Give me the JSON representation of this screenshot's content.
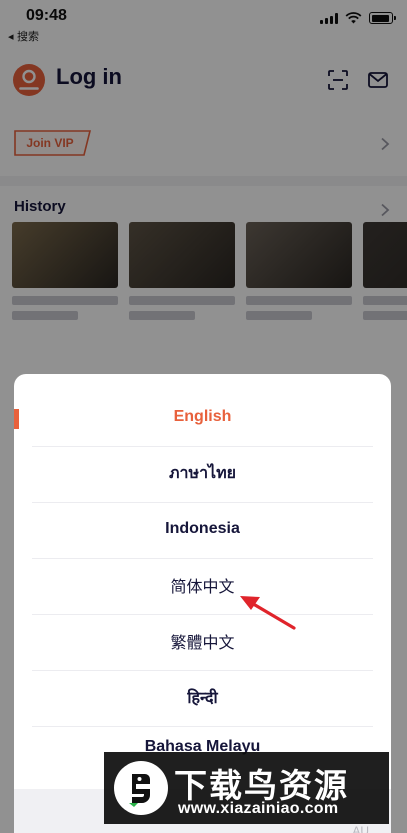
{
  "status_bar": {
    "time": "09:48",
    "back_app_label": "◂ 搜索",
    "battery_level": 0.9
  },
  "header": {
    "title": "Log in",
    "avatar_icon": "user-icon",
    "scan_icon": "scan-icon",
    "mail_icon": "mail-icon"
  },
  "vip": {
    "label": "Join VIP"
  },
  "history": {
    "title": "History",
    "items": [
      {
        "thumb_color": "#7b6a4c"
      },
      {
        "thumb_color": "#5e5446"
      },
      {
        "thumb_color": "#6b6258"
      },
      {
        "thumb_color": "#3f3a36"
      }
    ]
  },
  "language_sheet": {
    "options": [
      {
        "label": "English",
        "selected": true
      },
      {
        "label": "ภาษาไทย",
        "selected": false
      },
      {
        "label": "Indonesia",
        "selected": false
      },
      {
        "label": "简体中文",
        "selected": false
      },
      {
        "label": "繁體中文",
        "selected": false
      },
      {
        "label": "हिन्दी",
        "selected": false
      }
    ],
    "partial_option": "Bahasa Melayu",
    "bottom_corner_text": "AU"
  },
  "colors": {
    "accent": "#e8613c",
    "text_primary": "#16163a",
    "overlay": "rgba(0,0,0,0.43)",
    "arrow": "#e0242b"
  },
  "watermark": {
    "title": "下载鸟资源",
    "url": "www.xiazainiao.com"
  }
}
